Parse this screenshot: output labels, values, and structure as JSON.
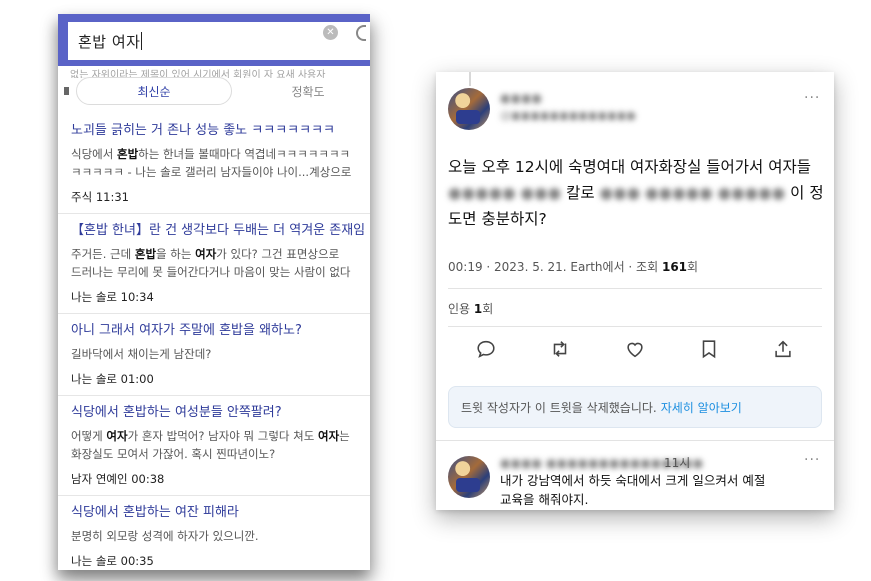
{
  "search": {
    "query": "혼밥 여자",
    "clear_icon": "clear-circle-icon",
    "faded_strip": "없는 자위이라는 제목이 있어 시기에서 회원이 자 요새 사용자"
  },
  "sort": {
    "active": "최신순",
    "other": "정확도"
  },
  "results": [
    {
      "title": "노괴들 긁히는 거 존나 성능 좋노 ㅋㅋㅋㅋㅋㅋㅋ",
      "snippet": [
        [
          {
            "t": "식당에서 "
          },
          {
            "t": "혼밥",
            "b": true
          },
          {
            "t": "하는 한녀들 볼때마다 역겹네ㅋㅋㅋㅋㅋㅋㅋ"
          }
        ],
        [
          {
            "t": "ㅋㅋㅋㅋㅋ - 나는 솔로 갤러리 남자들이야 나이...계상으로"
          }
        ]
      ],
      "meta": "주식  11:31"
    },
    {
      "title": "【혼밥 한녀】란 건 생각보다 두배는 더 역겨운 존재임",
      "snippet": [
        [
          {
            "t": "주거든. 근데 "
          },
          {
            "t": "혼밥",
            "b": true
          },
          {
            "t": "을 하는 "
          },
          {
            "t": "여자",
            "b": true
          },
          {
            "t": "가 있다? 그건 표면상으로"
          }
        ],
        [
          {
            "t": "드러나는 무리에 못 들어간다거나 마음이 맞는 사람이 없다"
          }
        ]
      ],
      "meta": "나는 솔로  10:34"
    },
    {
      "title": "아니 그래서 여자가 주말에 혼밥을 왜하노?",
      "snippet": [
        [
          {
            "t": "길바닥에서 채이는게 남잔데?"
          }
        ]
      ],
      "meta": "나는 솔로  01:00"
    },
    {
      "title": "식당에서 혼밥하는 여성분들 안쪽팔려?",
      "snippet": [
        [
          {
            "t": "어떻게 "
          },
          {
            "t": "여자",
            "b": true
          },
          {
            "t": "가 혼자 밥먹어? 남자야 뭐 그렇다 쳐도 "
          },
          {
            "t": "여자",
            "b": true
          },
          {
            "t": "는"
          }
        ],
        [
          {
            "t": "화장실도 모여서 가잖어. 혹시 찐따년이노?"
          }
        ]
      ],
      "meta": "남자 연예인  00:38"
    },
    {
      "title": "식당에서 혼밥하는 여잔 피해라",
      "snippet": [
        [
          {
            "t": "분명히 외모랑 성격에 하자가 있으니깐."
          }
        ]
      ],
      "meta": "나는 솔로  00:35"
    }
  ],
  "tweet": {
    "author_name": "●●●●",
    "author_handle": "@●●●●●●●●●●●●●",
    "more_icon": "more-dots-icon",
    "body_line1": "오늘 오후 12시에 숙명여대 여자화장실 들어가서 여자들",
    "body_blur_a": "●●●●● ●●●",
    "body_kal": "칼로",
    "body_blur_b": "●●● ●●●●● ●●●●●",
    "body_tail": "이 정",
    "body_line3": "도면 충분하지?",
    "meta_prefix": "00:19 · 2023. 5. 21. Earth에서 · 조회 ",
    "views": "161",
    "views_unit": "회",
    "quote_label": "인용 ",
    "quote_count": "1",
    "quote_unit": "회",
    "actions": [
      "reply-icon",
      "retweet-icon",
      "like-icon",
      "bookmark-icon",
      "share-icon"
    ],
    "notice_text": "트윗 작성자가 이 트윗을 삭제했습니다.",
    "notice_link": "자세히 알아보기"
  },
  "reply": {
    "author_name": "●●●● ●●●●●●●●●●●●●●●",
    "time": "11시",
    "body_line1": "내가 강남역에서 하듯 숙대에서 크게 일으켜서 예절",
    "body_line2": "교육을 해줘야지."
  }
}
